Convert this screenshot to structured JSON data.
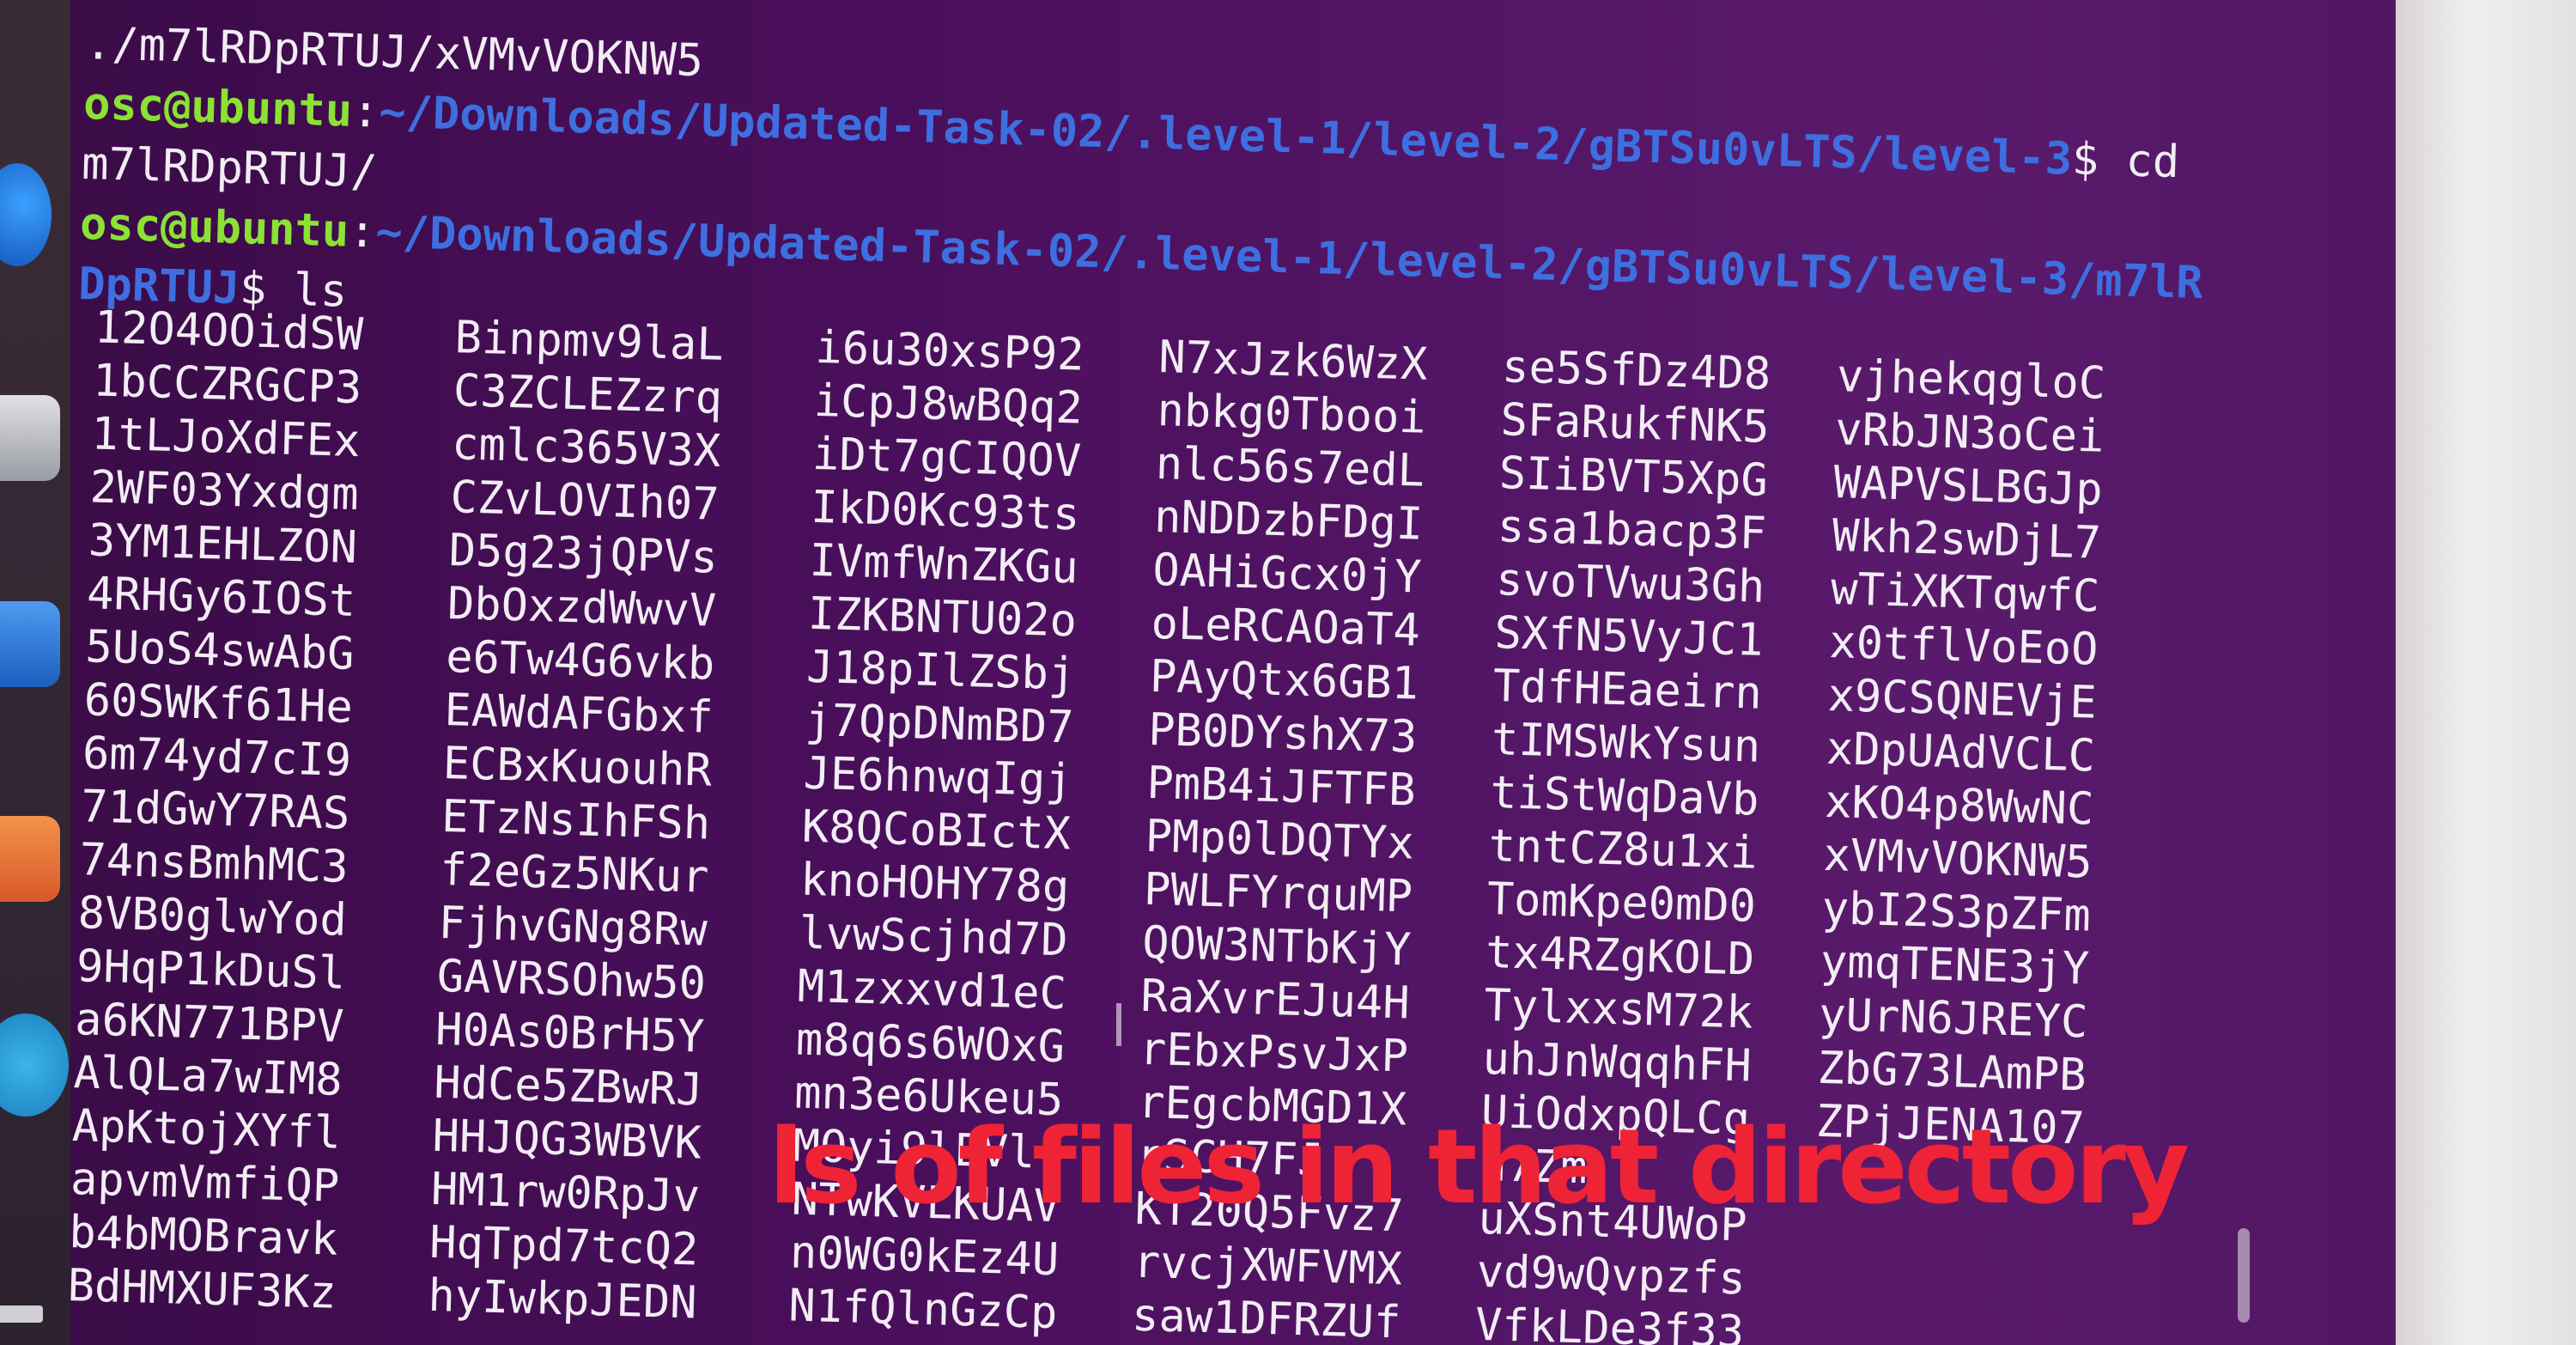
{
  "terminal": {
    "lines": [
      {
        "type": "output",
        "text": "./m7lRDpRTUJ/xVMvVOKNW5"
      },
      {
        "type": "prompt",
        "user": "osc@ubuntu",
        "sep": ":",
        "path": "~/Downloads/Updated-Task-02/.level-1/level-2/gBTSu0vLTS/level-3",
        "cmd": "$ cd"
      },
      {
        "type": "output",
        "text": "m7lRDpRTUJ/"
      },
      {
        "type": "prompt",
        "user": "osc@ubuntu",
        "sep": ":",
        "path": "~/Downloads/Updated-Task-02/.level-1/level-2/gBTSu0vLTS/level-3/m7lR",
        "cmd": ""
      },
      {
        "type": "prompt_cont",
        "path": "DpRTUJ",
        "cmd": "$ ls"
      }
    ],
    "listing": [
      [
        "12O4OOidSW",
        "1bCCZRGCP3",
        "1tLJoXdFEx",
        "2WF03Yxdgm",
        "3YM1EHLZON",
        "4RHGy6IOSt",
        "5UoS4swAbG",
        "60SWKf61He",
        "6m74yd7cI9",
        "71dGwY7RAS",
        "74nsBmhMC3",
        "8VB0glwYod",
        "9HqP1kDuSl",
        "a6KN771BPV",
        "AlQLa7wIM8",
        "ApKtojXYfl",
        "apvmVmfiQP",
        "b4bMOBravk",
        "BdHMXUF3Kz"
      ],
      [
        "Binpmv9laL",
        "C3ZCLEZzrq",
        "cmlc365V3X",
        "CZvLOVIh07",
        "D5g23jQPVs",
        "DbOxzdWwvV",
        "e6Tw4G6vkb",
        "EAWdAFGbxf",
        "ECBxKuouhR",
        "ETzNsIhFSh",
        "f2eGz5NKur",
        "FjhvGNg8Rw",
        "GAVRSOhw50",
        "H0As0BrH5Y",
        "HdCe5ZBwRJ",
        "HHJQG3WBVK",
        "HM1rw0RpJv",
        "HqTpd7tcQ2",
        "hyIwkpJEDN"
      ],
      [
        "i6u30xsP92",
        "iCpJ8wBQq2",
        "iDt7gCIQOV",
        "IkD0Kc93ts",
        "IVmfWnZKGu",
        "IZKBNTU02o",
        "J18pIlZSbj",
        "j7QpDNmBD7",
        "JE6hnwqIgj",
        "K8QCoBIctX",
        "knoHOHY78g",
        "lvwScjhd7D",
        "M1zxxvd1eC",
        "m8q6s6WOxG",
        "mn3e6Ukeu5",
        "MOyi9lEVl",
        "NTwKVLKUAV",
        "n0WG0kEz4U",
        "N1fQlnGzCp"
      ],
      [
        "N7xJzk6WzX",
        "nbkg0Tbooi",
        "nlc56s7edL",
        "nNDDzbFDgI",
        "OAHiGcx0jY",
        "oLeRCAOaT4",
        "PAyQtx6GB1",
        "PB0DYshX73",
        "PmB4iJFTFB",
        "PMp0lDQTYx",
        "PWLFYrquMP",
        "QOW3NTbKjY",
        "RaXvrEJu4H",
        "rEbxPsvJxP",
        "rEgcbMGD1X",
        "rSCH7FJ",
        "KT20Q5Fvz7",
        "rvcjXWFVMX",
        "saw1DFRZUf"
      ],
      [
        "se5SfDz4D8",
        "SFaRukfNK5",
        "SIiBVT5XpG",
        "ssa1bacp3F",
        "svoTVwu3Gh",
        "SXfN5VyJC1",
        "TdfHEaeirn",
        "tIMSWkYsun",
        "tiStWqDaVb",
        "tntCZ8u1xi",
        "TomKpe0mD0",
        "tx4RZgKOLD",
        "TylxxsM72k",
        "uhJnWqqhFH",
        "UiOdxpQLCg",
        "u7Zm",
        "uXSnt4UWoP",
        "vd9wQvpzfs",
        "VfkLDe3f33"
      ],
      [
        "vjhekqgloC",
        "vRbJN3oCei",
        "WAPVSLBGJp",
        "Wkh2swDjL7",
        "wTiXKTqwfC",
        "x0tflVoEoO",
        "x9CSQNEVjE",
        "xDpUAdVCLC",
        "xKO4p8WwNC",
        "xVMvVOKNW5",
        "ybI2S3pZFm",
        "ymqTENE3jY",
        "yUrN6JREYC",
        "ZbG73LAmPB",
        "ZPjJENA107",
        "",
        "",
        "",
        ""
      ]
    ]
  },
  "caption": "ls of files in that directory",
  "colors": {
    "prompt_user": "#8ae234",
    "prompt_path": "#3d6fe0",
    "caption": "#ef2336",
    "background": "#4a0f5c"
  },
  "dock_icons": [
    "browser-icon",
    "files-icon",
    "writer-icon",
    "software-center-icon",
    "help-icon",
    "show-apps-icon"
  ]
}
